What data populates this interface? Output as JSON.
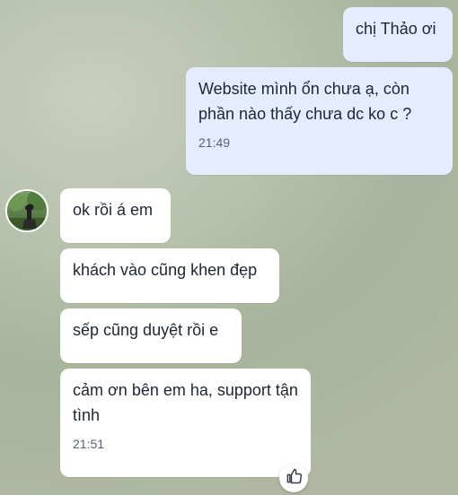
{
  "messages": [
    {
      "text": "chị Thảo ơi"
    },
    {
      "text": "Website mình ổn chưa ạ, còn phần nào thấy chưa dc ko c ?",
      "time": "21:49"
    },
    {
      "text": "ok rồi á em"
    },
    {
      "text": "khách vào cũng khen đẹp"
    },
    {
      "text": "sếp cũng duyệt rồi e"
    },
    {
      "text": "cảm ơn bên em ha, support tận tình",
      "time": "21:51"
    }
  ],
  "icons": {
    "avatar": "contact-avatar",
    "reaction": "thumbs-up-icon"
  },
  "colors": {
    "outgoing_bubble": "#e6ecff",
    "incoming_bubble": "#ffffff",
    "timestamp_text": "#55606e"
  }
}
